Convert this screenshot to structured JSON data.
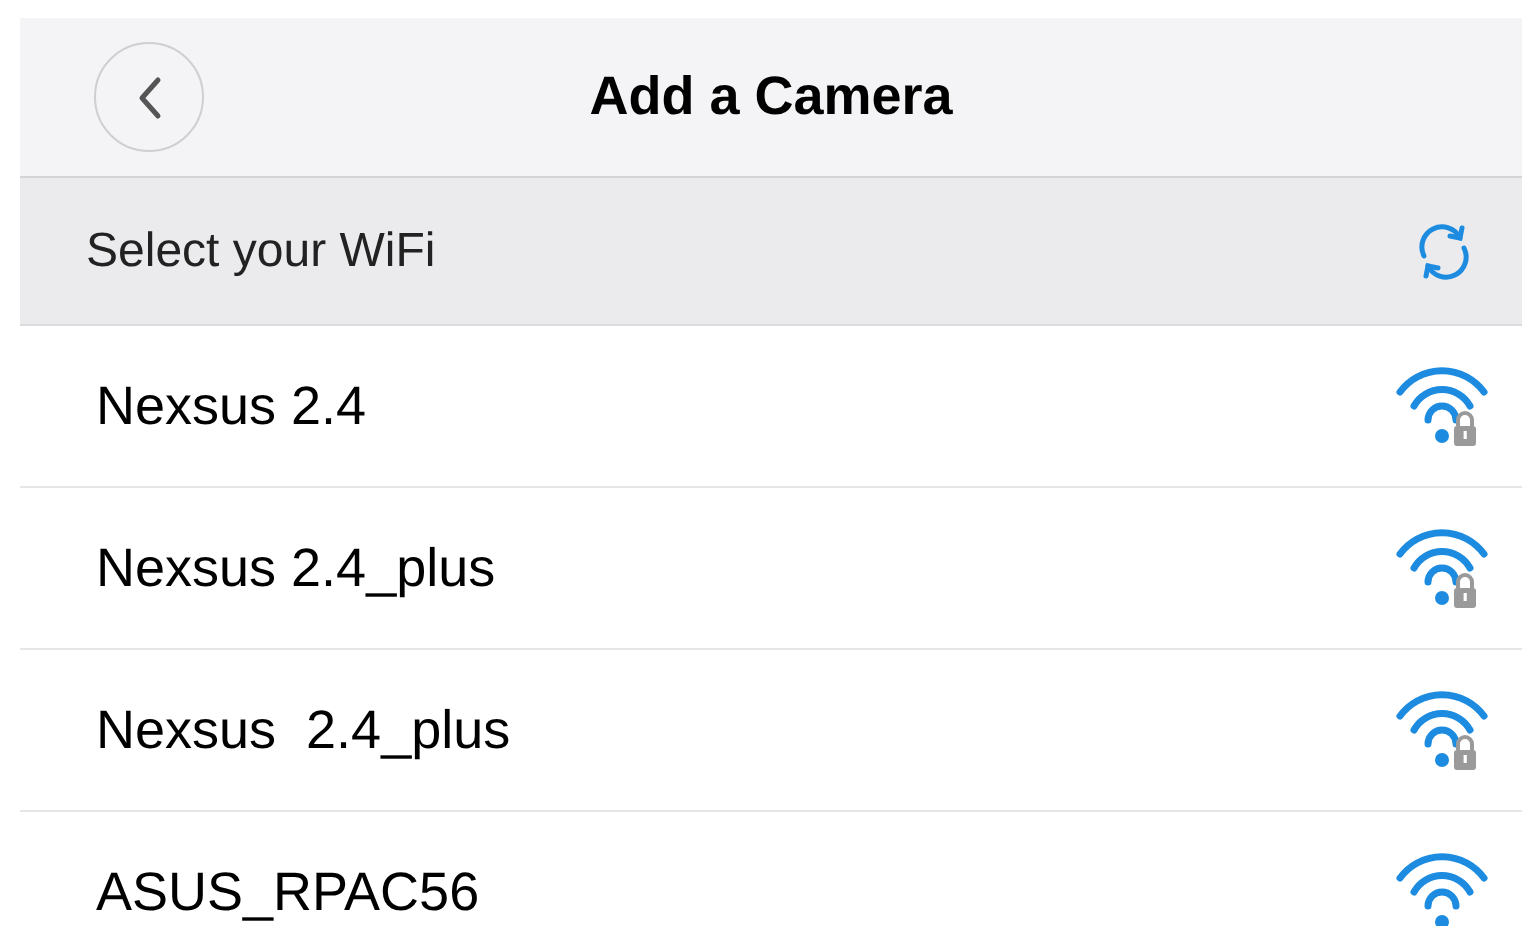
{
  "nav_bar": {
    "title": "Add a Camera"
  },
  "section_header": {
    "label": "Select your WiFi"
  },
  "networks": [
    {
      "name": "Nexsus 2.4",
      "locked": true
    },
    {
      "name": "Nexsus 2.4_plus",
      "locked": true
    },
    {
      "name": "Nexsus  2.4_plus",
      "locked": true
    },
    {
      "name": "ASUS_RPAC56",
      "locked": false
    }
  ]
}
